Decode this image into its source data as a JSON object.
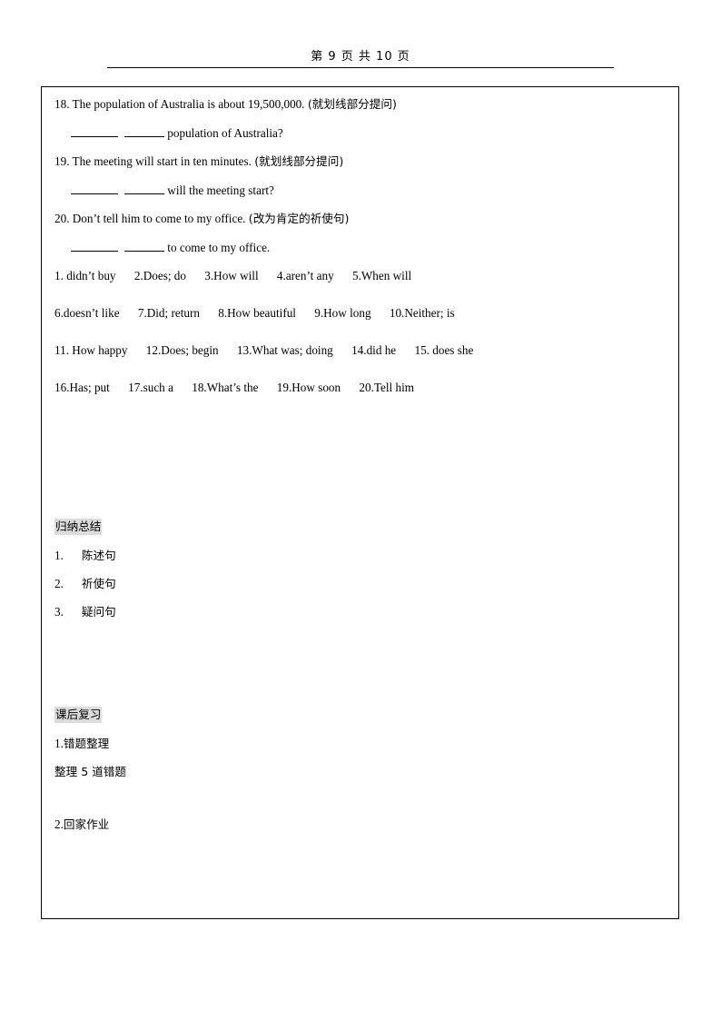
{
  "header": {
    "page_label": "第 9 页 共 10 页"
  },
  "exercises": [
    {
      "number": "18.",
      "english": "The population of Australia is about 19,500,000.",
      "chinese_hint": "(就划线部分提问)",
      "answer_tail": "population of Australia?"
    },
    {
      "number": "19.",
      "english": "The meeting will start in ten minutes.",
      "chinese_hint": "(就划线部分提问)",
      "answer_tail": "will the meeting start?"
    },
    {
      "number": "20.",
      "english": "Don’t tell him to come to my office.",
      "chinese_hint": "(改为肯定的祈使句)",
      "answer_tail": "to come to my office."
    }
  ],
  "answer_key": [
    {
      "items": [
        "1. didn’t buy",
        "2.Does; do",
        "3.How will",
        "4.aren’t any",
        "5.When will"
      ]
    },
    {
      "items": [
        "6.doesn’t like",
        "7.Did; return",
        "8.How beautiful",
        "9.How long",
        "10.Neither; is"
      ]
    },
    {
      "items": [
        "11. How happy",
        "12.Does; begin",
        "13.What was; doing",
        "14.did he",
        "15. does she"
      ]
    },
    {
      "items": [
        "16.Has; put",
        "17.such a",
        "18.What’s the",
        "19.How soon",
        "20.Tell him"
      ]
    }
  ],
  "summary_section": {
    "title": "归纳总结",
    "items": [
      {
        "num": "1.",
        "text": "陈述句"
      },
      {
        "num": "2.",
        "text": "祈使句"
      },
      {
        "num": "3.",
        "text": "疑问句"
      }
    ]
  },
  "review_section": {
    "title": "课后复习",
    "item1_num": "1.",
    "item1_text": "错题整理",
    "item1_detail": "整理 5 道错题",
    "item2_num": "2.",
    "item2_text": "回家作业"
  }
}
